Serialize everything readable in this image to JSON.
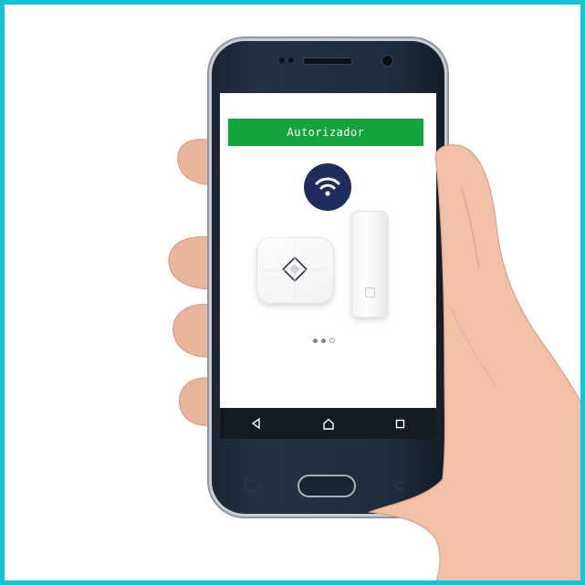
{
  "app": {
    "header_label": "Autorizador"
  },
  "screen": {
    "wifi_icon": "wifi-icon",
    "products": [
      "smart-hub-device",
      "door-sensor-device"
    ],
    "pager": {
      "total": 3,
      "active_index": 0
    }
  },
  "navbar": {
    "icons": [
      "back-triangle-icon",
      "home-outline-icon",
      "recents-square-icon"
    ]
  },
  "colors": {
    "frame_border": "#17c2d6",
    "header_bg": "#15a33f",
    "wifi_badge_bg": "#1e2d5c",
    "phone_body": "#1e2b3b",
    "navbar_bg": "#141a22"
  }
}
